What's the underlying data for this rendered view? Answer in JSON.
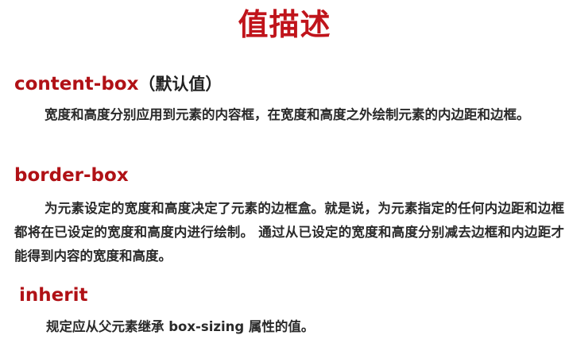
{
  "slide": {
    "title": "值描述",
    "items": [
      {
        "keyword": "content-box",
        "note": "（默认值）",
        "description": "宽度和高度分别应用到元素的内容框，在宽度和高度之外绘制元素的内边距和边框。"
      },
      {
        "keyword": "border-box",
        "description": "为元素设定的宽度和高度决定了元素的边框盒。就是说，为元素指定的任何内边距和边框都将在已设定的宽度和高度内进行绘制。 通过从已设定的宽度和高度分别减去边框和内边距才能得到内容的宽度和高度。"
      },
      {
        "keyword": "inherit",
        "description": "规定应从父元素继承 box-sizing 属性的值。"
      }
    ]
  },
  "colors": {
    "title": "#c0141b",
    "keyword": "#b01116",
    "body_text": "#2a2a2a",
    "background": "#ffffff"
  }
}
